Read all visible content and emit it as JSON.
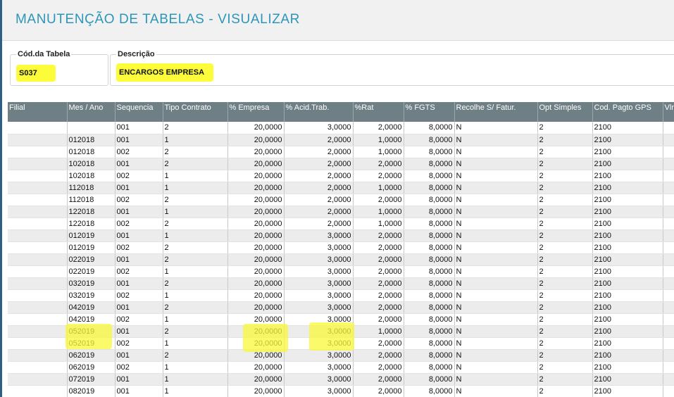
{
  "page": {
    "title": "MANUTENÇÃO DE TABELAS - VISUALIZAR"
  },
  "fields": {
    "code": {
      "label": "Cód.da Tabela",
      "value": "S037"
    },
    "description": {
      "label": "Descrição",
      "value": "ENCARGOS EMPRESA"
    }
  },
  "grid": {
    "columns": [
      "Filial",
      "Mes / Ano",
      "Sequencia",
      "Tipo Contrato",
      "% Empresa",
      "% Acid.Trab.",
      "%Rat",
      "% FGTS",
      "Recolhe S/ Fatur.",
      "Opt Simples",
      "Cod. Pagto GPS",
      "Vlr"
    ],
    "rows": [
      [
        "",
        "",
        "001",
        "2",
        "20,0000",
        "3,0000",
        "2,0000",
        "8,0000",
        "N",
        "2",
        "2100",
        ""
      ],
      [
        "",
        "012018",
        "001",
        "1",
        "20,0000",
        "2,0000",
        "1,0000",
        "8,0000",
        "N",
        "2",
        "2100",
        ""
      ],
      [
        "",
        "012018",
        "002",
        "2",
        "20,0000",
        "2,0000",
        "1,0000",
        "8,0000",
        "N",
        "2",
        "2100",
        ""
      ],
      [
        "",
        "102018",
        "001",
        "2",
        "20,0000",
        "2,0000",
        "2,0000",
        "8,0000",
        "N",
        "2",
        "2100",
        ""
      ],
      [
        "",
        "102018",
        "002",
        "1",
        "20,0000",
        "2,0000",
        "2,0000",
        "8,0000",
        "N",
        "2",
        "2100",
        ""
      ],
      [
        "",
        "112018",
        "001",
        "1",
        "20,0000",
        "2,0000",
        "1,0000",
        "8,0000",
        "N",
        "2",
        "2100",
        ""
      ],
      [
        "",
        "112018",
        "002",
        "2",
        "20,0000",
        "2,0000",
        "2,0000",
        "8,0000",
        "N",
        "2",
        "2100",
        ""
      ],
      [
        "",
        "122018",
        "001",
        "1",
        "20,0000",
        "2,0000",
        "1,0000",
        "8,0000",
        "N",
        "2",
        "2100",
        ""
      ],
      [
        "",
        "122018",
        "002",
        "2",
        "20,0000",
        "2,0000",
        "1,0000",
        "8,0000",
        "N",
        "2",
        "2100",
        ""
      ],
      [
        "",
        "012019",
        "001",
        "1",
        "20,0000",
        "3,0000",
        "2,0000",
        "8,0000",
        "N",
        "2",
        "2100",
        ""
      ],
      [
        "",
        "012019",
        "002",
        "2",
        "20,0000",
        "3,0000",
        "2,0000",
        "8,0000",
        "N",
        "2",
        "2100",
        ""
      ],
      [
        "",
        "022019",
        "001",
        "2",
        "20,0000",
        "3,0000",
        "2,0000",
        "8,0000",
        "N",
        "2",
        "2100",
        ""
      ],
      [
        "",
        "022019",
        "002",
        "1",
        "20,0000",
        "3,0000",
        "2,0000",
        "8,0000",
        "N",
        "2",
        "2100",
        ""
      ],
      [
        "",
        "032019",
        "001",
        "2",
        "20,0000",
        "3,0000",
        "2,0000",
        "8,0000",
        "N",
        "2",
        "2100",
        ""
      ],
      [
        "",
        "032019",
        "002",
        "1",
        "20,0000",
        "3,0000",
        "2,0000",
        "8,0000",
        "N",
        "2",
        "2100",
        ""
      ],
      [
        "",
        "042019",
        "001",
        "2",
        "20,0000",
        "3,0000",
        "2,0000",
        "8,0000",
        "N",
        "2",
        "2100",
        ""
      ],
      [
        "",
        "042019",
        "002",
        "1",
        "20,0000",
        "3,0000",
        "2,0000",
        "8,0000",
        "N",
        "2",
        "2100",
        ""
      ],
      [
        "",
        "052019",
        "001",
        "2",
        "20,0000",
        "3,0000",
        "1,0000",
        "8,0000",
        "N",
        "2",
        "2100",
        ""
      ],
      [
        "",
        "052019",
        "002",
        "1",
        "20,0000",
        "3,0000",
        "2,0000",
        "8,0000",
        "N",
        "2",
        "2100",
        ""
      ],
      [
        "",
        "062019",
        "001",
        "2",
        "20,0000",
        "3,0000",
        "2,0000",
        "8,0000",
        "N",
        "2",
        "2100",
        ""
      ],
      [
        "",
        "062019",
        "002",
        "1",
        "20,0000",
        "3,0000",
        "2,0000",
        "8,0000",
        "N",
        "2",
        "2100",
        ""
      ],
      [
        "",
        "072019",
        "001",
        "1",
        "20,0000",
        "3,0000",
        "2,0000",
        "8,0000",
        "N",
        "2",
        "2100",
        ""
      ],
      [
        "",
        "082019",
        "001",
        "1",
        "20,0000",
        "3,0000",
        "2,0000",
        "8,0000",
        "N",
        "2",
        "2100",
        ""
      ]
    ]
  },
  "colors": {
    "title": "#2b96b9",
    "grid_header": "#6e7f86",
    "highlight": "#fcfc3a"
  }
}
